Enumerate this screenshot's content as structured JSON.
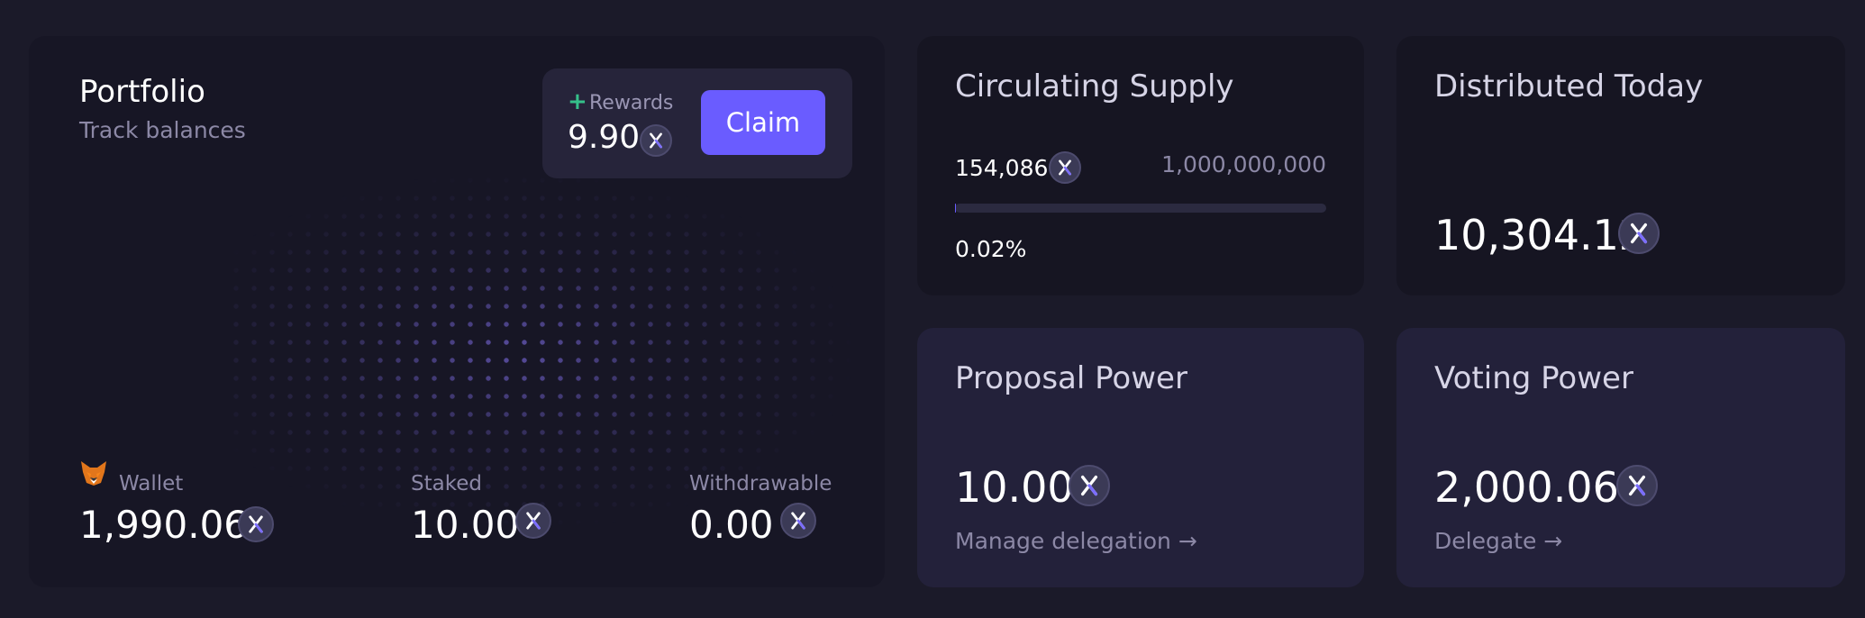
{
  "portfolio": {
    "title": "Portfolio",
    "subtitle": "Track balances",
    "rewards": {
      "label": "Rewards",
      "value": "9.90",
      "claim_label": "Claim"
    },
    "balances": [
      {
        "label": "Wallet",
        "value": "1,990.06",
        "icon": "metamask-fox-icon"
      },
      {
        "label": "Staked",
        "value": "10.00"
      },
      {
        "label": "Withdrawable",
        "value": "0.00"
      }
    ]
  },
  "supply": {
    "title": "Circulating Supply",
    "current": "154,086",
    "max": "1,000,000,000",
    "percent_label": "0.02%",
    "fraction": 0.0002
  },
  "distributed": {
    "title": "Distributed Today",
    "value": "10,304.12"
  },
  "proposal": {
    "title": "Proposal Power",
    "value": "10.00",
    "link": "Manage delegation →"
  },
  "voting": {
    "title": "Voting Power",
    "value": "2,000.06",
    "link": "Delegate →"
  },
  "colors": {
    "accent": "#6a5cff",
    "positive": "#35c08a",
    "background": "#1b1a29",
    "muted_text": "#8c88a6"
  },
  "token_icon": "x-token-icon"
}
